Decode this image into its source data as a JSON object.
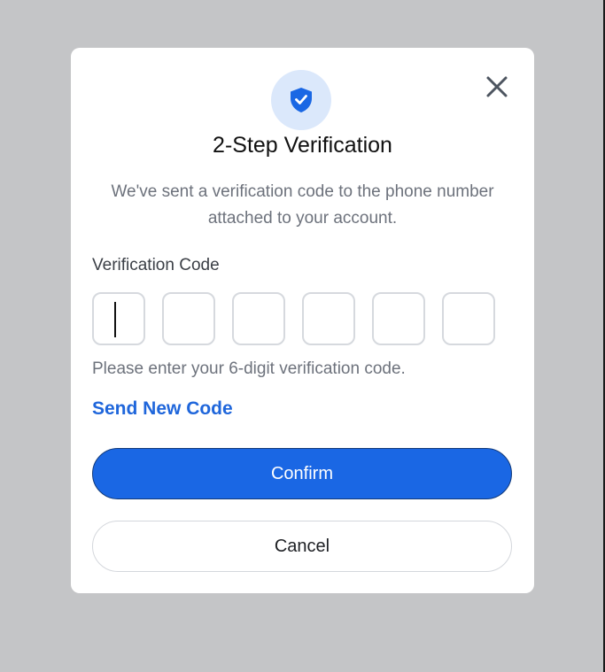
{
  "dialog": {
    "title": "2-Step Verification",
    "subtitle": "We've sent a verification code to the phone number attached to your account.",
    "field_label": "Verification Code",
    "code_digits": [
      "",
      "",
      "",
      "",
      "",
      ""
    ],
    "hint": "Please enter your 6-digit verification code.",
    "send_new_code": "Send New Code",
    "confirm_label": "Confirm",
    "cancel_label": "Cancel"
  },
  "icons": {
    "header": "shield-check-icon",
    "close": "close-icon"
  },
  "colors": {
    "accent": "#1a67e4",
    "link": "#1f66db",
    "icon_bg": "#dbe8fb",
    "overlay": "#c4c5c7"
  }
}
